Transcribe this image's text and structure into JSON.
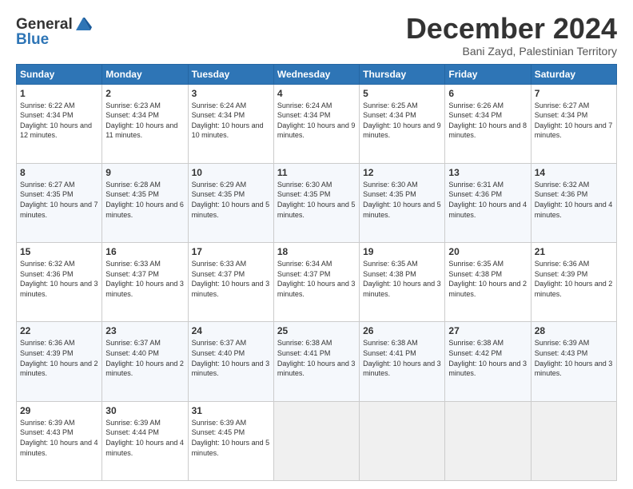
{
  "header": {
    "logo_line1": "General",
    "logo_line2": "Blue",
    "month": "December 2024",
    "location": "Bani Zayd, Palestinian Territory"
  },
  "weekdays": [
    "Sunday",
    "Monday",
    "Tuesday",
    "Wednesday",
    "Thursday",
    "Friday",
    "Saturday"
  ],
  "weeks": [
    [
      {
        "day": "1",
        "sunrise": "6:22 AM",
        "sunset": "4:34 PM",
        "daylight": "10 hours and 12 minutes."
      },
      {
        "day": "2",
        "sunrise": "6:23 AM",
        "sunset": "4:34 PM",
        "daylight": "10 hours and 11 minutes."
      },
      {
        "day": "3",
        "sunrise": "6:24 AM",
        "sunset": "4:34 PM",
        "daylight": "10 hours and 10 minutes."
      },
      {
        "day": "4",
        "sunrise": "6:24 AM",
        "sunset": "4:34 PM",
        "daylight": "10 hours and 9 minutes."
      },
      {
        "day": "5",
        "sunrise": "6:25 AM",
        "sunset": "4:34 PM",
        "daylight": "10 hours and 9 minutes."
      },
      {
        "day": "6",
        "sunrise": "6:26 AM",
        "sunset": "4:34 PM",
        "daylight": "10 hours and 8 minutes."
      },
      {
        "day": "7",
        "sunrise": "6:27 AM",
        "sunset": "4:34 PM",
        "daylight": "10 hours and 7 minutes."
      }
    ],
    [
      {
        "day": "8",
        "sunrise": "6:27 AM",
        "sunset": "4:35 PM",
        "daylight": "10 hours and 7 minutes."
      },
      {
        "day": "9",
        "sunrise": "6:28 AM",
        "sunset": "4:35 PM",
        "daylight": "10 hours and 6 minutes."
      },
      {
        "day": "10",
        "sunrise": "6:29 AM",
        "sunset": "4:35 PM",
        "daylight": "10 hours and 5 minutes."
      },
      {
        "day": "11",
        "sunrise": "6:30 AM",
        "sunset": "4:35 PM",
        "daylight": "10 hours and 5 minutes."
      },
      {
        "day": "12",
        "sunrise": "6:30 AM",
        "sunset": "4:35 PM",
        "daylight": "10 hours and 5 minutes."
      },
      {
        "day": "13",
        "sunrise": "6:31 AM",
        "sunset": "4:36 PM",
        "daylight": "10 hours and 4 minutes."
      },
      {
        "day": "14",
        "sunrise": "6:32 AM",
        "sunset": "4:36 PM",
        "daylight": "10 hours and 4 minutes."
      }
    ],
    [
      {
        "day": "15",
        "sunrise": "6:32 AM",
        "sunset": "4:36 PM",
        "daylight": "10 hours and 3 minutes."
      },
      {
        "day": "16",
        "sunrise": "6:33 AM",
        "sunset": "4:37 PM",
        "daylight": "10 hours and 3 minutes."
      },
      {
        "day": "17",
        "sunrise": "6:33 AM",
        "sunset": "4:37 PM",
        "daylight": "10 hours and 3 minutes."
      },
      {
        "day": "18",
        "sunrise": "6:34 AM",
        "sunset": "4:37 PM",
        "daylight": "10 hours and 3 minutes."
      },
      {
        "day": "19",
        "sunrise": "6:35 AM",
        "sunset": "4:38 PM",
        "daylight": "10 hours and 3 minutes."
      },
      {
        "day": "20",
        "sunrise": "6:35 AM",
        "sunset": "4:38 PM",
        "daylight": "10 hours and 2 minutes."
      },
      {
        "day": "21",
        "sunrise": "6:36 AM",
        "sunset": "4:39 PM",
        "daylight": "10 hours and 2 minutes."
      }
    ],
    [
      {
        "day": "22",
        "sunrise": "6:36 AM",
        "sunset": "4:39 PM",
        "daylight": "10 hours and 2 minutes."
      },
      {
        "day": "23",
        "sunrise": "6:37 AM",
        "sunset": "4:40 PM",
        "daylight": "10 hours and 2 minutes."
      },
      {
        "day": "24",
        "sunrise": "6:37 AM",
        "sunset": "4:40 PM",
        "daylight": "10 hours and 3 minutes."
      },
      {
        "day": "25",
        "sunrise": "6:38 AM",
        "sunset": "4:41 PM",
        "daylight": "10 hours and 3 minutes."
      },
      {
        "day": "26",
        "sunrise": "6:38 AM",
        "sunset": "4:41 PM",
        "daylight": "10 hours and 3 minutes."
      },
      {
        "day": "27",
        "sunrise": "6:38 AM",
        "sunset": "4:42 PM",
        "daylight": "10 hours and 3 minutes."
      },
      {
        "day": "28",
        "sunrise": "6:39 AM",
        "sunset": "4:43 PM",
        "daylight": "10 hours and 3 minutes."
      }
    ],
    [
      {
        "day": "29",
        "sunrise": "6:39 AM",
        "sunset": "4:43 PM",
        "daylight": "10 hours and 4 minutes."
      },
      {
        "day": "30",
        "sunrise": "6:39 AM",
        "sunset": "4:44 PM",
        "daylight": "10 hours and 4 minutes."
      },
      {
        "day": "31",
        "sunrise": "6:39 AM",
        "sunset": "4:45 PM",
        "daylight": "10 hours and 5 minutes."
      },
      null,
      null,
      null,
      null
    ]
  ]
}
